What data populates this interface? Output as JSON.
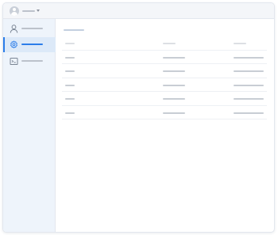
{
  "header": {
    "user_name": "",
    "avatar_icon": "user-avatar-icon",
    "menu_icon": "chevron-down-icon"
  },
  "sidebar": {
    "items": [
      {
        "label": "",
        "icon": "user-icon",
        "active": false
      },
      {
        "label": "",
        "icon": "gear-icon",
        "active": true
      },
      {
        "label": "",
        "icon": "terminal-icon",
        "active": false
      }
    ]
  },
  "main": {
    "title": "",
    "table": {
      "columns": [
        "",
        "",
        ""
      ],
      "rows": [
        [
          "",
          "",
          ""
        ],
        [
          "",
          "",
          ""
        ],
        [
          "",
          "",
          ""
        ],
        [
          "",
          "",
          ""
        ],
        [
          "",
          "",
          ""
        ]
      ]
    }
  },
  "colors": {
    "accent": "#2b7de9",
    "sidebar_bg": "#eef4fb",
    "placeholder": "#c8cdd4"
  }
}
